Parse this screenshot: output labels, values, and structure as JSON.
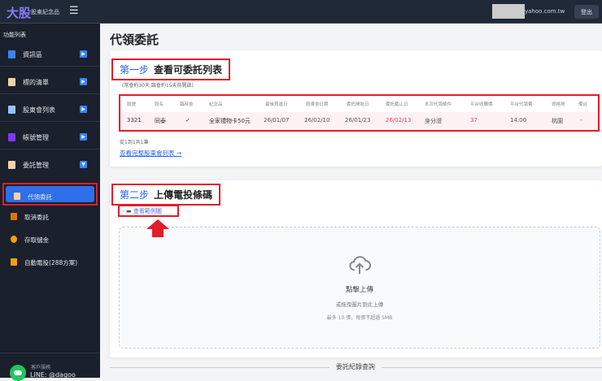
{
  "header": {
    "logo": "大股",
    "subtitle": "股東紀念品",
    "email": "yahoo.com.tw",
    "logout": "登出"
  },
  "sidebar": {
    "heading": "功能列表",
    "items": [
      {
        "label": "資訊區",
        "color": "#3b82f6"
      },
      {
        "label": "標的清單",
        "color": "#f5d0a9"
      },
      {
        "label": "股東會列表",
        "color": "#93c5fd"
      },
      {
        "label": "帳號管理",
        "color": "#7c3aed"
      },
      {
        "label": "委託管理",
        "color": "#f5d0a9"
      }
    ],
    "sub": [
      {
        "label": "代領委託",
        "color": "#f5d0a9"
      },
      {
        "label": "取消委託",
        "color": "#d97706"
      },
      {
        "label": "存取儲金",
        "color": "#f59e0b"
      },
      {
        "label": "自動電投(288方案)",
        "color": "#f59e0b"
      }
    ],
    "support_label": "客戶服務",
    "support_value": "LINE: @dagoo"
  },
  "main": {
    "title": "代領委託",
    "step1": {
      "num": "第一步",
      "title": "查看可委託列表",
      "note": "(常會約30天,臨會約15天前開啟)"
    },
    "table": {
      "headers": [
        "股號",
        "股名",
        "臨時會",
        "紀念品",
        "最後買進日",
        "股東會日期",
        "委託開始日",
        "委託截止日",
        "本次代領條件",
        "平台收購價",
        "平台代領費",
        "資格地",
        "備註"
      ],
      "rows": [
        [
          "3321",
          "同泰",
          "✓",
          "全家禮物卡50元",
          "26/01/07",
          "26/02/10",
          "26/01/23",
          "26/02/13",
          "身分證",
          "37",
          "14.00",
          "桃園",
          "-"
        ]
      ]
    },
    "count": "從1到1共1筆",
    "full_link": "查看完整股東會列表 →",
    "step2": {
      "num": "第二步",
      "title": "上傳電投條碼"
    },
    "example_link": "查看範例圖",
    "upload": {
      "title": "點擊上傳",
      "sub": "或拖曳圖片到此上傳",
      "limit": "最多 10 張，每張不超過 5MB"
    },
    "records": "委託紀錄查詢"
  }
}
